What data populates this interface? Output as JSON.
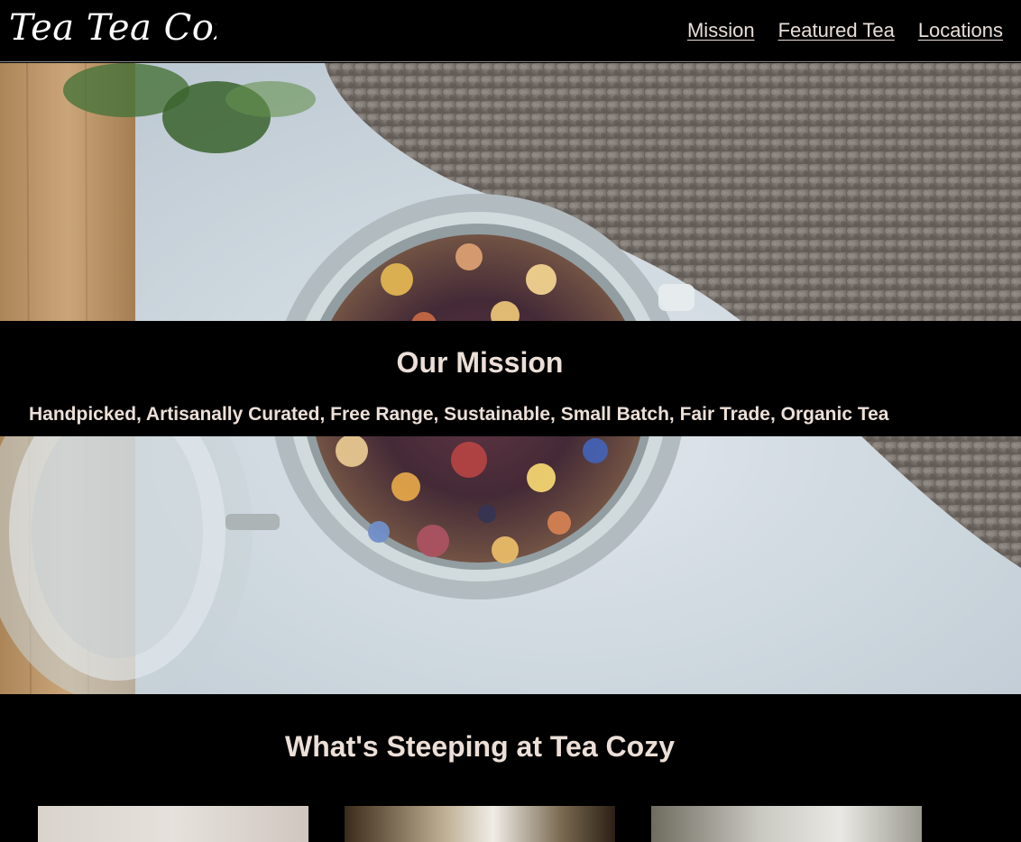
{
  "header": {
    "logo_text": "Tea Tea Cozy",
    "nav": [
      {
        "label": "Mission"
      },
      {
        "label": "Featured Tea"
      },
      {
        "label": "Locations"
      }
    ]
  },
  "mission": {
    "title": "Our Mission",
    "text": "Handpicked, Artisanally Curated, Free Range, Sustainable, Small Batch, Fair Trade, Organic Tea"
  },
  "featured": {
    "title": "What's Steeping at Tea Cozy"
  }
}
